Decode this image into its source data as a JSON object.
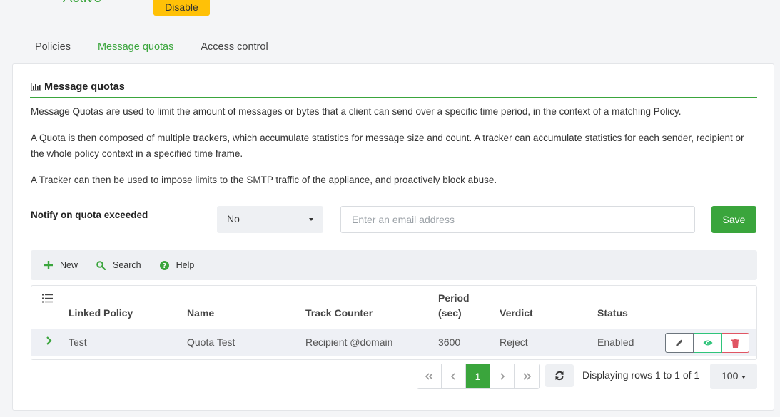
{
  "header": {
    "status": "Active",
    "disable_label": "Disable"
  },
  "tabs": [
    {
      "label": "Policies"
    },
    {
      "label": "Message quotas"
    },
    {
      "label": "Access control"
    }
  ],
  "section": {
    "title": "Message quotas",
    "paragraphs": [
      "Message Quotas are used to limit the amount of messages or bytes that a client can send over a specific time period, in the context of a matching Policy.",
      "A Quota is then composed of multiple trackers, which accumulate statistics for message size and count. A tracker can accumulate statistics for each sender, recipient or the whole policy context in a specified time frame.",
      "A Tracker can then be used to impose limits to the SMTP traffic of the appliance, and proactively block abuse."
    ]
  },
  "notify": {
    "label": "Notify on quota exceeded",
    "select_value": "No",
    "email_placeholder": "Enter an email address",
    "save_label": "Save"
  },
  "toolbar": {
    "new_label": "New",
    "search_label": "Search",
    "help_label": "Help"
  },
  "table": {
    "columns": [
      "Linked Policy",
      "Name",
      "Track Counter",
      "Period\n(sec)",
      "Verdict",
      "Status"
    ],
    "rows": [
      {
        "linked_policy": "Test",
        "name": "Quota Test",
        "track_counter": "Recipient @domain",
        "period": "3600",
        "verdict": "Reject",
        "status": "Enabled"
      }
    ]
  },
  "pagination": {
    "current_page": "1",
    "rows_text": "Displaying rows 1 to 1 of 1",
    "per_page": "100"
  },
  "colors": {
    "accent": "#3aa53c",
    "warning": "#ffc107",
    "danger": "#e05563",
    "view": "#2fc47a"
  }
}
